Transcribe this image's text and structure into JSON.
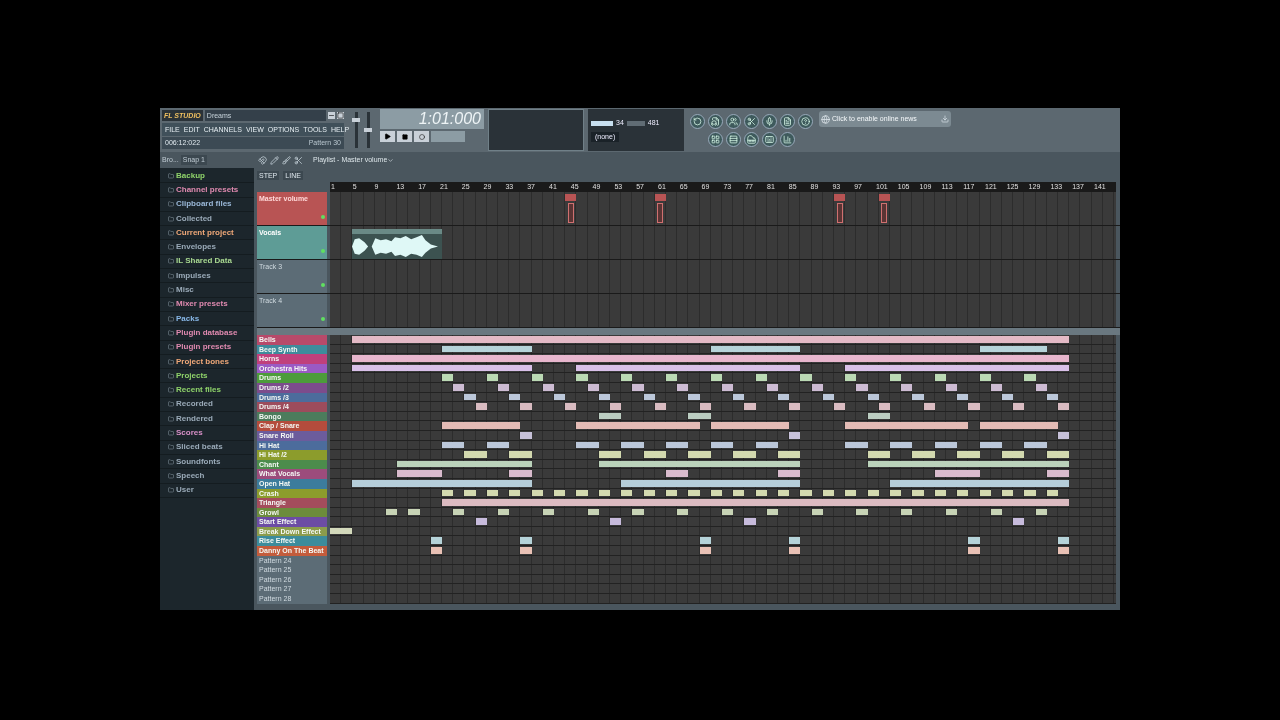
{
  "window": {
    "title": "Dreams"
  },
  "logo": "FL STUDIO",
  "menu": [
    "FILE",
    "EDIT",
    "CHANNELS",
    "VIEW",
    "OPTIONS",
    "TOOLS",
    "HELP"
  ],
  "hint_bar": {
    "position": "006:12:022",
    "pattern": "Pattern 30"
  },
  "master_volume": {
    "level": 0.8
  },
  "master_pitch": {
    "level": 0.5
  },
  "song_time": "1:01:000",
  "meters": [
    "34",
    "481"
  ],
  "news": {
    "placeholder": "Click to enable online news"
  },
  "output_select": {
    "value": "(none)"
  },
  "browser": {
    "title": "Bro...",
    "snap": "Snap 1",
    "items": [
      {
        "name": "Backup",
        "color": "#8fd36a"
      },
      {
        "name": "Channel presets",
        "color": "#e08ab0"
      },
      {
        "name": "Clipboard files",
        "color": "#9ab8d8"
      },
      {
        "name": "Collected",
        "color": "#9aaab8"
      },
      {
        "name": "Current project",
        "color": "#f0a878"
      },
      {
        "name": "Envelopes",
        "color": "#9aaab8"
      },
      {
        "name": "IL Shared Data",
        "color": "#a8d890"
      },
      {
        "name": "Impulses",
        "color": "#9aaab8"
      },
      {
        "name": "Misc",
        "color": "#9aaab8"
      },
      {
        "name": "Mixer presets",
        "color": "#e08ab0"
      },
      {
        "name": "Packs",
        "color": "#88b8e8"
      },
      {
        "name": "Plugin database",
        "color": "#e08ab0"
      },
      {
        "name": "Plugin presets",
        "color": "#e08ab0"
      },
      {
        "name": "Project bones",
        "color": "#f0a878"
      },
      {
        "name": "Projects",
        "color": "#8fd36a"
      },
      {
        "name": "Recent files",
        "color": "#8fd36a"
      },
      {
        "name": "Recorded",
        "color": "#9aaab8"
      },
      {
        "name": "Rendered",
        "color": "#9aaab8"
      },
      {
        "name": "Scores",
        "color": "#d890c8"
      },
      {
        "name": "Sliced beats",
        "color": "#9aaab8"
      },
      {
        "name": "Soundfonts",
        "color": "#9aaab8"
      },
      {
        "name": "Speech",
        "color": "#9aaab8"
      },
      {
        "name": "User",
        "color": "#9aaab8"
      }
    ]
  },
  "playlist": {
    "title": "Playlist - Master volume",
    "modes": [
      "STEP",
      "LINE"
    ],
    "ruler": [
      "1",
      "5",
      "9",
      "13",
      "17",
      "21",
      "25",
      "29",
      "33",
      "37",
      "41",
      "45",
      "49",
      "53",
      "57",
      "61",
      "65",
      "69",
      "73",
      "77",
      "81",
      "85",
      "89",
      "93",
      "97",
      "101",
      "105",
      "109",
      "113",
      "117",
      "121",
      "125",
      "129",
      "133",
      "137",
      "141"
    ],
    "tracks": [
      {
        "name": "Master volume",
        "kind": "automation",
        "color": "#b85454"
      },
      {
        "name": "Vocals",
        "kind": "audio",
        "color": "#5e9c96"
      },
      {
        "name": "Track 3",
        "kind": "empty",
        "color": "#5c6c76"
      },
      {
        "name": "Track 4",
        "kind": "empty",
        "color": "#5c6c76"
      }
    ],
    "patterns": [
      {
        "name": "Bells",
        "color": "#b84a6a"
      },
      {
        "name": "Beep Synth",
        "color": "#3e8c9c"
      },
      {
        "name": "Horns",
        "color": "#c0407c"
      },
      {
        "name": "Orchestra Hits",
        "color": "#9a5ac4"
      },
      {
        "name": "Drums",
        "color": "#4c9c3a"
      },
      {
        "name": "Drums /2",
        "color": "#7c4c8c"
      },
      {
        "name": "Drums /3",
        "color": "#4c6c9c"
      },
      {
        "name": "Drums /4",
        "color": "#9c4c5c"
      },
      {
        "name": "Bongo",
        "color": "#4c7c5c"
      },
      {
        "name": "Clap / Snare",
        "color": "#b44c3c"
      },
      {
        "name": "Snare Roll",
        "color": "#6c5c9c"
      },
      {
        "name": "Hi Hat",
        "color": "#4c6c9c"
      },
      {
        "name": "Hi Hat /2",
        "color": "#8c9c2c"
      },
      {
        "name": "Chant",
        "color": "#4c8c4c"
      },
      {
        "name": "What Vocals",
        "color": "#9c4c7c"
      },
      {
        "name": "Open Hat",
        "color": "#3c7c9c"
      },
      {
        "name": "Crash",
        "color": "#8c9c2c"
      },
      {
        "name": "Triangle",
        "color": "#a44c5c"
      },
      {
        "name": "Growl",
        "color": "#6c8c3c"
      },
      {
        "name": "Start Effect",
        "color": "#6c4ca4"
      },
      {
        "name": "Break Down Effect",
        "color": "#8c9c4c"
      },
      {
        "name": "Rise Effect",
        "color": "#3c8c9c"
      },
      {
        "name": "Danny On The Beat",
        "color": "#c45c3c"
      },
      {
        "name": "Pattern 24",
        "color": "#5c6c76"
      },
      {
        "name": "Pattern 25",
        "color": "#5c6c76"
      },
      {
        "name": "Pattern 26",
        "color": "#5c6c76"
      },
      {
        "name": "Pattern 27",
        "color": "#5c6c76"
      },
      {
        "name": "Pattern 28",
        "color": "#5c6c76"
      }
    ]
  }
}
